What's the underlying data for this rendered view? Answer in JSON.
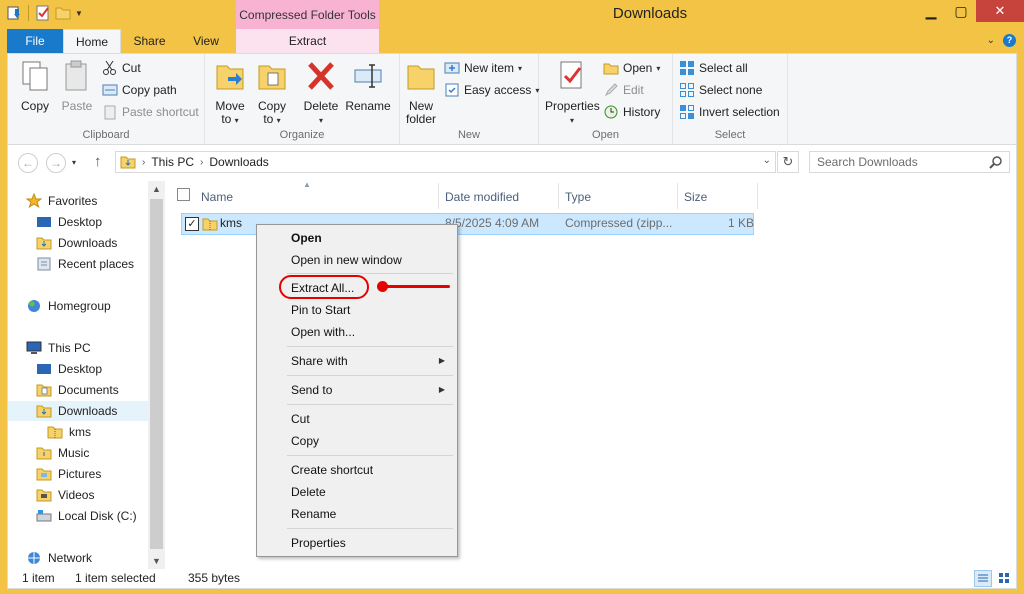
{
  "window": {
    "title": "Downloads",
    "context_tab_header": "Compressed Folder Tools",
    "controls": [
      "minimize",
      "maximize",
      "close"
    ]
  },
  "ribbon_tabs": {
    "file": "File",
    "home": "Home",
    "share": "Share",
    "view": "View",
    "extract": "Extract"
  },
  "ribbon": {
    "clipboard": {
      "label": "Clipboard",
      "copy": "Copy",
      "paste": "Paste",
      "cut": "Cut",
      "copy_path": "Copy path",
      "paste_shortcut": "Paste shortcut"
    },
    "organize": {
      "label": "Organize",
      "move_to": "Move",
      "move_to_2": "to",
      "copy_to": "Copy",
      "copy_to_2": "to",
      "delete": "Delete",
      "rename": "Rename"
    },
    "new": {
      "label": "New",
      "new_folder": "New",
      "new_folder_2": "folder",
      "new_item": "New item",
      "easy_access": "Easy access"
    },
    "open": {
      "label": "Open",
      "properties": "Properties",
      "open": "Open",
      "edit": "Edit",
      "history": "History"
    },
    "select": {
      "label": "Select",
      "select_all": "Select all",
      "select_none": "Select none",
      "invert_selection": "Invert selection"
    }
  },
  "address": {
    "crumbs": [
      "This PC",
      "Downloads"
    ],
    "search_placeholder": "Search Downloads"
  },
  "nav": {
    "favorites": "Favorites",
    "fav_desktop": "Desktop",
    "fav_downloads": "Downloads",
    "fav_recent": "Recent places",
    "homegroup": "Homegroup",
    "this_pc": "This PC",
    "pc_desktop": "Desktop",
    "pc_documents": "Documents",
    "pc_downloads": "Downloads",
    "pc_kms": "kms",
    "pc_music": "Music",
    "pc_pictures": "Pictures",
    "pc_videos": "Videos",
    "pc_local_disk": "Local Disk (C:)",
    "network": "Network"
  },
  "columns": {
    "name": "Name",
    "date_modified": "Date modified",
    "type": "Type",
    "size": "Size"
  },
  "files": [
    {
      "name": "kms",
      "date_modified": "8/5/2025 4:09 AM",
      "type": "Compressed (zipp...",
      "size": "1 KB",
      "checked": true
    }
  ],
  "context_menu": {
    "open": "Open",
    "open_new_window": "Open in new window",
    "extract_all": "Extract All...",
    "pin_to_start": "Pin to Start",
    "open_with": "Open with...",
    "share_with": "Share with",
    "send_to": "Send to",
    "cut": "Cut",
    "copy": "Copy",
    "create_shortcut": "Create shortcut",
    "delete": "Delete",
    "rename": "Rename",
    "properties": "Properties"
  },
  "status": {
    "item_count": "1 item",
    "selected": "1 item selected",
    "selected_size": "355 bytes"
  },
  "colors": {
    "title_bar": "#f3c345",
    "file_tab": "#1979ca",
    "context_tab": "#f8b3d3",
    "selection": "#cce8ff",
    "annotation": "#e60000"
  }
}
